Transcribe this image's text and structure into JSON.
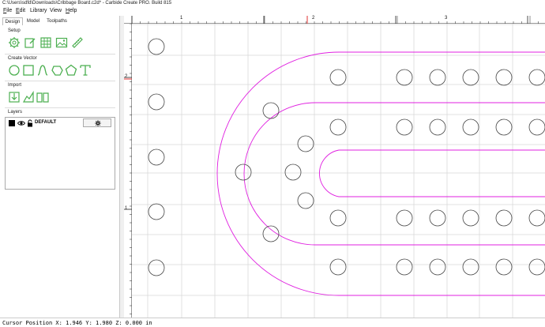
{
  "window": {
    "title": "C:\\Users\\sdfd\\Downloads\\Cribbage Board.c2d* - Carbide Create PRO. Build 815"
  },
  "menu": [
    {
      "label": "File",
      "key": "F",
      "rest": "ile"
    },
    {
      "label": "Edit",
      "key": "E",
      "rest": "dit"
    },
    {
      "label": "Library",
      "key": "",
      "rest": "Library"
    },
    {
      "label": "View",
      "key": "",
      "rest": "View"
    },
    {
      "label": "Help",
      "key": "H",
      "rest": "elp"
    }
  ],
  "tabs": [
    "Design",
    "Model",
    "Toolpaths"
  ],
  "sections": {
    "setup": "Setup",
    "create_vector": "Create Vector",
    "import": "Import",
    "layers": "Layers"
  },
  "icons": {
    "setup": [
      "gear-settings-icon",
      "edit-document-icon",
      "grid-icon",
      "image-icon",
      "ruler-icon"
    ],
    "create_vector": [
      "circle-icon",
      "rectangle-icon",
      "curve-icon",
      "polygon-icon",
      "pentagon-icon",
      "text-icon"
    ],
    "import": [
      "import-icon",
      "trace-icon",
      "book-icon"
    ]
  },
  "layer": {
    "name": "DEFAULT",
    "color": "#000000"
  },
  "ruler": {
    "top_labels": [
      "1",
      "2",
      "3"
    ],
    "left_labels": [
      "2",
      "1"
    ]
  },
  "status": {
    "text": "Cursor Position X: 1.946 Y: 1.980 Z: 0.000 in"
  },
  "colors": {
    "accent_green": "#4caf50",
    "toolpath_magenta": "#e020e0",
    "grid": "#d9d9d9",
    "ruler_marker": "#e03030"
  }
}
